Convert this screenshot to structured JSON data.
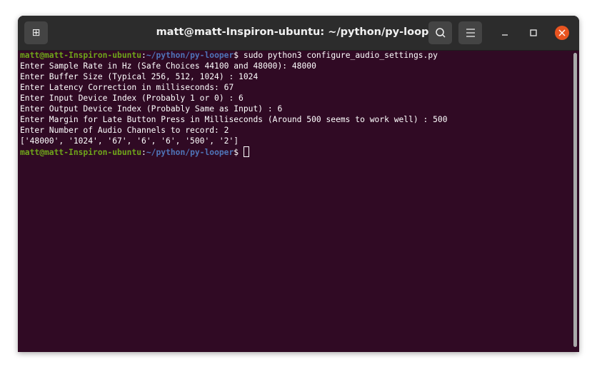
{
  "window": {
    "title": "matt@matt-Inspiron-ubuntu: ~/python/py-looper"
  },
  "terminal": {
    "prompt_user": "matt@matt-Inspiron-ubuntu",
    "prompt_path": "~/python/py-looper",
    "prompt_symbol": "$",
    "command": " sudo python3 configure_audio_settings.py",
    "output": [
      "Enter Sample Rate in Hz (Safe Choices 44100 and 48000): 48000",
      "Enter Buffer Size (Typical 256, 512, 1024) : 1024",
      "Enter Latency Correction in milliseconds: 67",
      "Enter Input Device Index (Probably 1 or 0) : 6",
      "Enter Output Device Index (Probably Same as Input) : 6",
      "Enter Margin for Late Button Press in Milliseconds (Around 500 seems to work well) : 500",
      "Enter Number of Audio Channels to record: 2",
      "['48000', '1024', '67', '6', '6', '500', '2']"
    ]
  }
}
